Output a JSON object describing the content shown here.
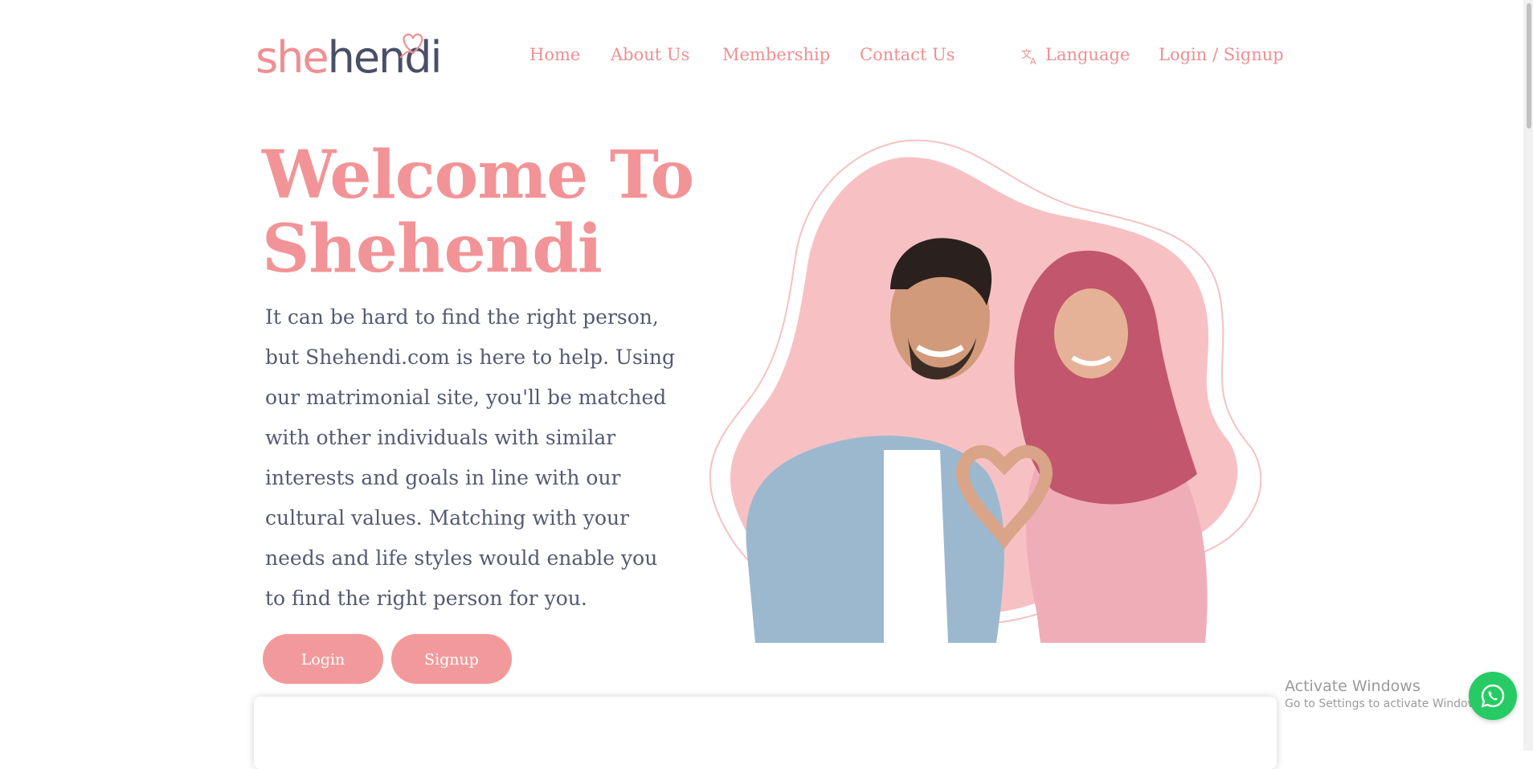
{
  "logo": {
    "prefix": "she",
    "suffix": "hendi"
  },
  "nav": {
    "home": "Home",
    "about": "About Us",
    "membership": "Membership",
    "contact": "Contact Us",
    "language": "Language",
    "login_signup": "Login / Signup"
  },
  "hero": {
    "title_line1": "Welcome To",
    "title_line2": "Shehendi",
    "description": "It can be hard to find the right person, but Shehendi.com is here to help. Using our matrimonial site, you'll be matched with other individuals with similar interests and goals in line with our cultural values. Matching with your needs and life styles would enable you to find the right person for you.",
    "login_button": "Login",
    "signup_button": "Signup"
  },
  "os_overlay": {
    "title": "Activate Windows",
    "subtitle": "Go to Settings to activate Windows."
  },
  "icons": {
    "language": "translate-icon",
    "chat": "whatsapp-icon",
    "logo_ornament": "heart-icon"
  },
  "colors": {
    "brand_pink": "#ef8f91",
    "brand_dark": "#4a4f68",
    "button_pink": "#f29a9b",
    "text_body": "#555a72",
    "whatsapp_green": "#26cc63"
  }
}
